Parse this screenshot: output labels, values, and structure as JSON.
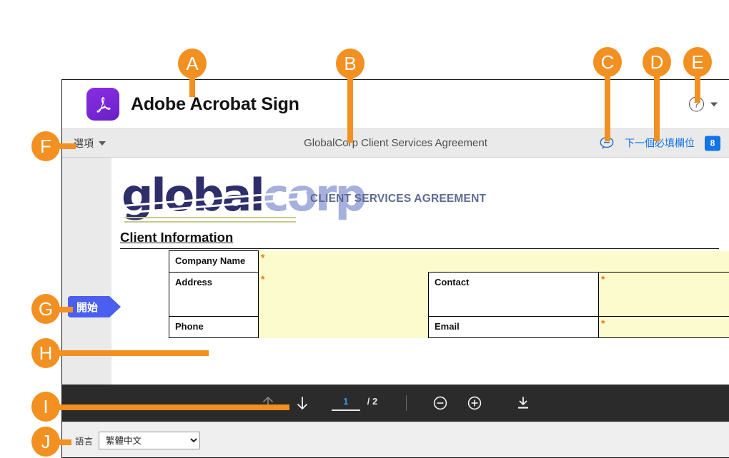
{
  "app": {
    "logo_icon": "acrobat-logo-icon",
    "title": "Adobe Acrobat Sign",
    "help_icon": "question-mark-icon",
    "help_caret_icon": "chevron-down-icon"
  },
  "sub_toolbar": {
    "options_label": "選項",
    "options_caret_icon": "chevron-down-icon",
    "document_title": "GlobalCorp Client Services Agreement",
    "comment_icon": "comment-bubble-icon",
    "next_field_label": "下一個必填欄位",
    "required_field_count": "8"
  },
  "document": {
    "logo_text_primary": "global",
    "logo_text_secondary": "corp",
    "header_right": "CLIENT SERVICES AGREEMENT",
    "section_heading": "Client Information",
    "start_tag": "開始",
    "required_marker": "*",
    "rows": [
      {
        "label": "Company Name",
        "required": true
      },
      {
        "label": "Address",
        "required": true
      },
      {
        "label": "Contact",
        "required": true
      },
      {
        "label": "Phone",
        "required": false
      },
      {
        "label": "Email",
        "required": true
      }
    ]
  },
  "bottom_toolbar": {
    "prev_page_icon": "arrow-up-icon",
    "next_page_icon": "arrow-down-icon",
    "page_number": "1",
    "page_total": "/ 2",
    "zoom_out_icon": "minus-circle-icon",
    "zoom_in_icon": "plus-circle-icon",
    "download_icon": "download-icon"
  },
  "language_bar": {
    "label": "語言",
    "selected": "繁體中文",
    "options": [
      "繁體中文"
    ]
  },
  "callouts": [
    {
      "letter": "A"
    },
    {
      "letter": "B"
    },
    {
      "letter": "C"
    },
    {
      "letter": "D"
    },
    {
      "letter": "E"
    },
    {
      "letter": "F"
    },
    {
      "letter": "G"
    },
    {
      "letter": "H"
    },
    {
      "letter": "I"
    },
    {
      "letter": "J"
    }
  ],
  "colors": {
    "accent_orange": "#f29021",
    "link_blue": "#1473e6",
    "badge_blue": "#1473e6",
    "start_tag_blue": "#4a5ef0",
    "field_yellow": "#fbfbcd",
    "toolbar_dark": "#2b2b2b",
    "logo_purple": "#7a28d6"
  }
}
